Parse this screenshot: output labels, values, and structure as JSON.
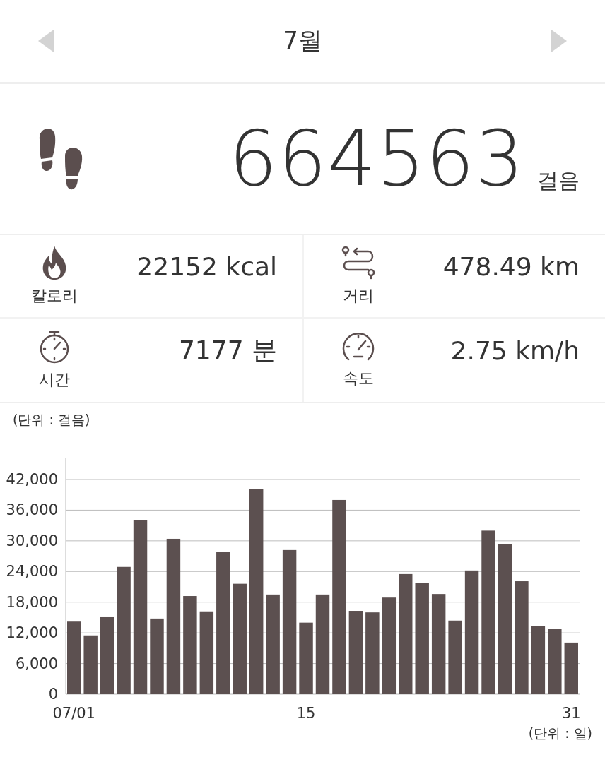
{
  "header": {
    "title": "7월"
  },
  "steps": {
    "value": "664563",
    "unit": "걸음"
  },
  "stats": [
    {
      "kind": "calories",
      "label": "칼로리",
      "value": "22152 kcal"
    },
    {
      "kind": "distance",
      "label": "거리",
      "value": "478.49 km"
    },
    {
      "kind": "time",
      "label": "시간",
      "value": "7177 분"
    },
    {
      "kind": "speed",
      "label": "속도",
      "value": "2.75 km/h"
    }
  ],
  "chart": {
    "unit_label": "(단위 : 걸음)",
    "x_unit_label": "(단위 : 일)",
    "chart_data": {
      "type": "bar",
      "x": [
        1,
        2,
        3,
        4,
        5,
        6,
        7,
        8,
        9,
        10,
        11,
        12,
        13,
        14,
        15,
        16,
        17,
        18,
        19,
        20,
        21,
        22,
        23,
        24,
        25,
        26,
        27,
        28,
        29,
        30,
        31
      ],
      "series": [
        {
          "color": "#5c5050",
          "values": [
            14200,
            11500,
            15200,
            24900,
            34000,
            14800,
            30400,
            19200,
            16200,
            27900,
            21600,
            40200,
            19500,
            28200,
            14000,
            19500,
            38000,
            16300,
            16000,
            18900,
            23500,
            21700,
            19600,
            14400,
            24200,
            32000,
            29400,
            22100,
            13300,
            12800,
            10100
          ]
        }
      ],
      "xlim": [
        0.5,
        31.5
      ],
      "ylim": [
        0,
        42000
      ],
      "grid": true,
      "yticks": [
        {
          "value": 0,
          "label": "0"
        },
        {
          "value": 6000,
          "label": "6,000"
        },
        {
          "value": 12000,
          "label": "12,000"
        },
        {
          "value": 18000,
          "label": "18,000"
        },
        {
          "value": 24000,
          "label": "24,000"
        },
        {
          "value": 30000,
          "label": "30,000"
        },
        {
          "value": 36000,
          "label": "36,000"
        },
        {
          "value": 42000,
          "label": "42,000"
        }
      ],
      "xticks": [
        {
          "value": 1,
          "label": "07/01"
        },
        {
          "value": 15,
          "label": "15"
        },
        {
          "value": 31,
          "label": "31"
        }
      ]
    }
  }
}
